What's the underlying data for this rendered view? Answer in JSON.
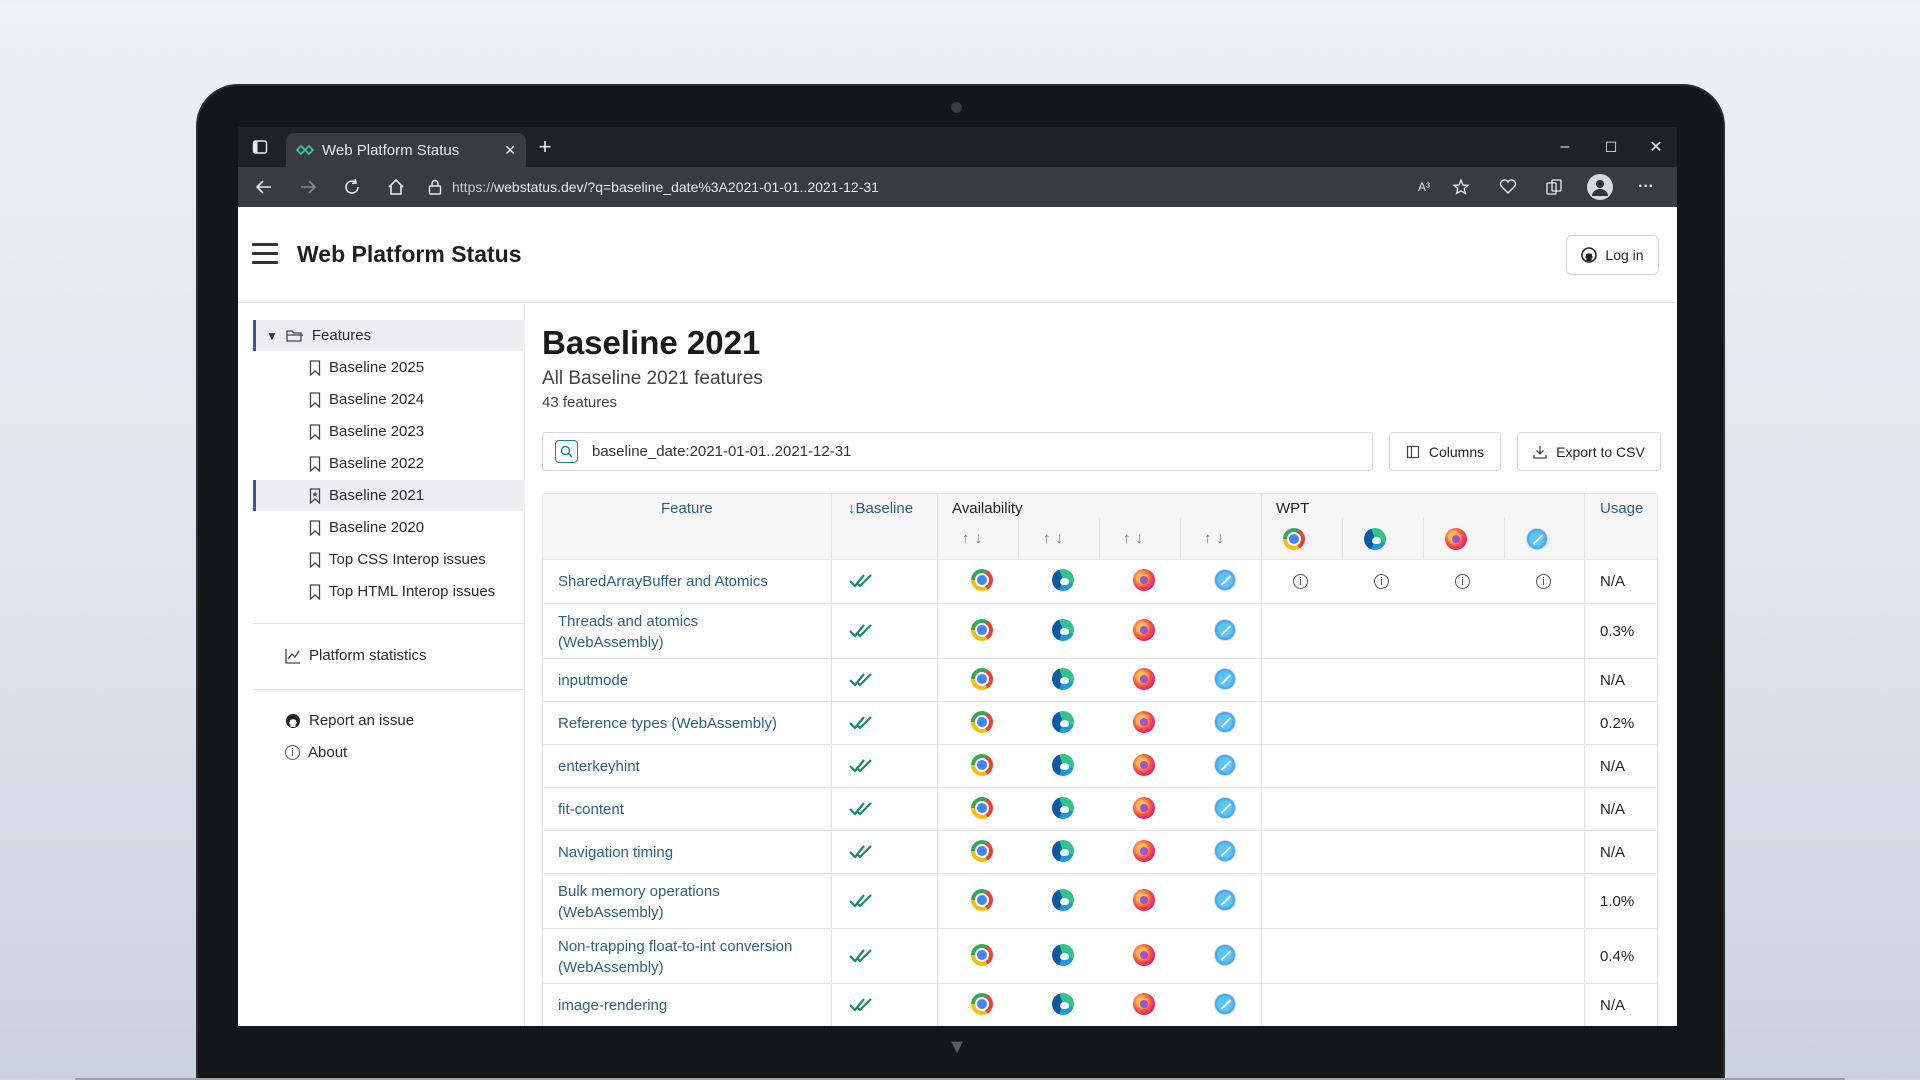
{
  "browser": {
    "tab_title": "Web Platform Status",
    "new_tab": "+",
    "close_tab": "✕",
    "url_scheme": "https://",
    "url_rest": "webstatus.dev/?q=baseline_date%3A2021-01-01..2021-12-31",
    "window_minimize": "–",
    "window_maximize": "☐",
    "window_close": "✕",
    "read_aloud": "A³",
    "more": "···"
  },
  "header": {
    "title": "Web Platform Status",
    "login_label": "Log in"
  },
  "sidebar": {
    "features_label": "Features",
    "items": [
      {
        "label": "Baseline 2025"
      },
      {
        "label": "Baseline 2024"
      },
      {
        "label": "Baseline 2023"
      },
      {
        "label": "Baseline 2022"
      },
      {
        "label": "Baseline 2021",
        "active": true
      },
      {
        "label": "Baseline 2020"
      },
      {
        "label": "Top CSS Interop issues"
      },
      {
        "label": "Top HTML Interop issues"
      }
    ],
    "stats_label": "Platform statistics",
    "report_label": "Report an issue",
    "about_label": "About"
  },
  "main": {
    "title": "Baseline 2021",
    "subtitle": "All Baseline 2021 features",
    "count": "43 features",
    "search_value": "baseline_date:2021-01-01..2021-12-31",
    "columns_label": "Columns",
    "export_label": "Export to CSV"
  },
  "table": {
    "headers": {
      "feature": "Feature",
      "baseline": "↓Baseline",
      "availability": "Availability",
      "wpt": "WPT",
      "usage": "Usage",
      "sort": "↑↓"
    },
    "info_glyph": "i",
    "rows": [
      {
        "feature": "SharedArrayBuffer and Atomics",
        "usage": "N/A",
        "wpt_info": true
      },
      {
        "feature": "Threads and atomics (WebAssembly)",
        "usage": "0.3%"
      },
      {
        "feature": "inputmode",
        "usage": "N/A"
      },
      {
        "feature": "Reference types (WebAssembly)",
        "usage": "0.2%"
      },
      {
        "feature": "enterkeyhint",
        "usage": "N/A"
      },
      {
        "feature": "fit-content",
        "usage": "N/A"
      },
      {
        "feature": "Navigation timing",
        "usage": "N/A"
      },
      {
        "feature": "Bulk memory operations (WebAssembly)",
        "usage": "1.0%"
      },
      {
        "feature": "Non-trapping float-to-int conversion (WebAssembly)",
        "usage": "0.4%"
      },
      {
        "feature": "image-rendering",
        "usage": "N/A"
      }
    ]
  },
  "colors": {
    "link": "#2b5f8e",
    "baseline_check": "#1c8a6a",
    "active_border": "#2b5f8e"
  }
}
